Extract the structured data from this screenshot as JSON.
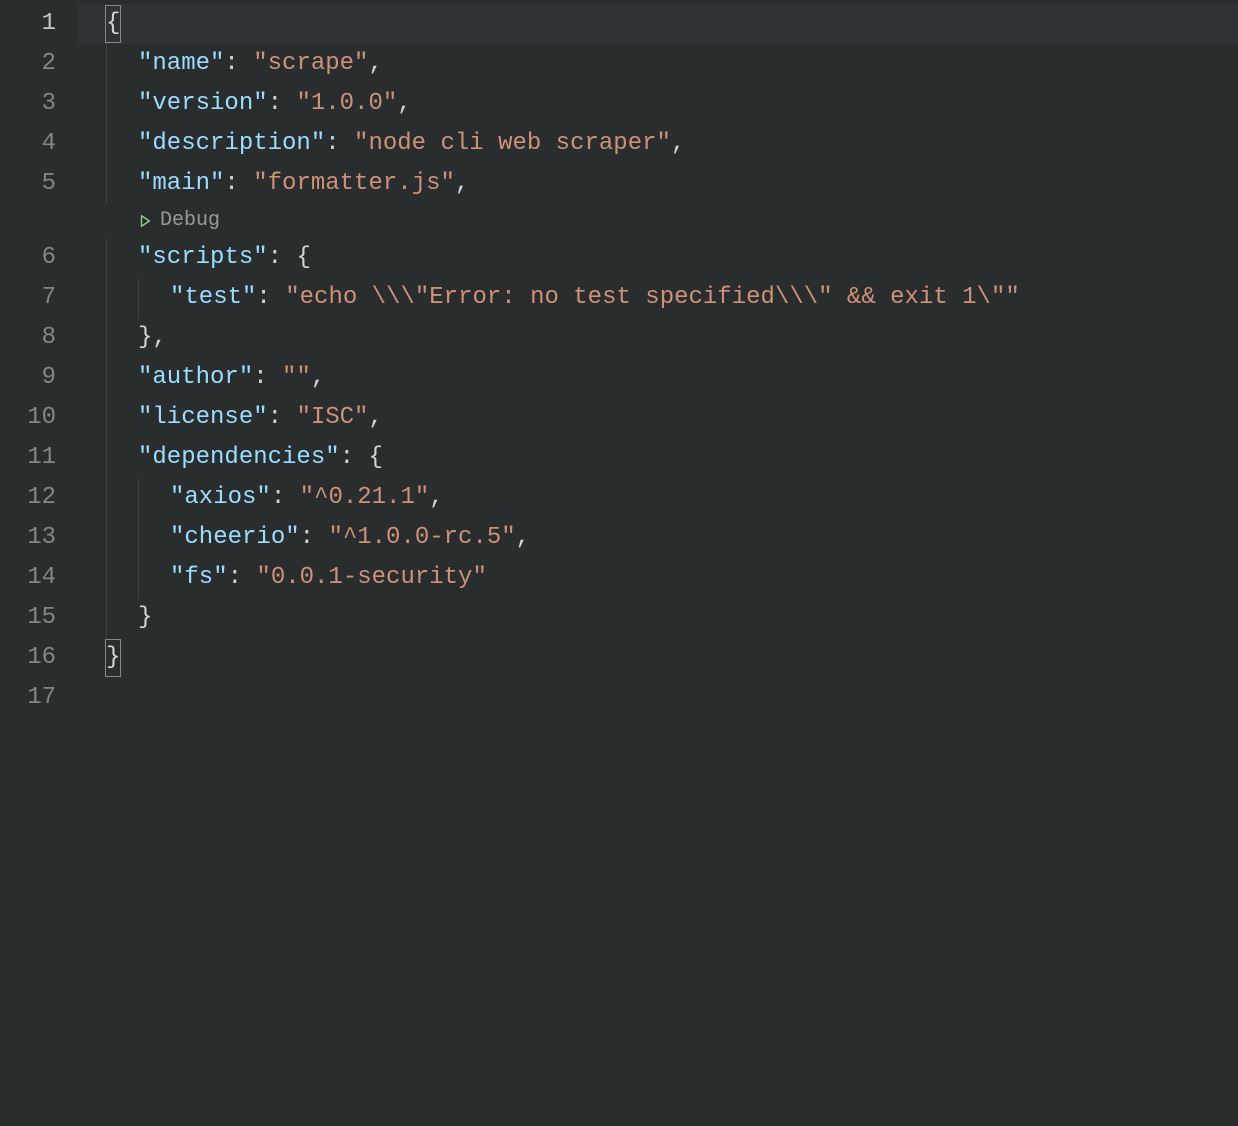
{
  "editor": {
    "line_numbers": [
      "1",
      "2",
      "3",
      "4",
      "5",
      "6",
      "7",
      "8",
      "9",
      "10",
      "11",
      "12",
      "13",
      "14",
      "15",
      "16",
      "17"
    ],
    "current_line_index": 0,
    "codelens": {
      "label": "Debug",
      "before_line_index": 5
    },
    "json": {
      "name_key": "\"name\"",
      "name_val": "\"scrape\"",
      "version_key": "\"version\"",
      "version_val": "\"1.0.0\"",
      "description_key": "\"description\"",
      "description_val": "\"node cli web scraper\"",
      "main_key": "\"main\"",
      "main_val": "\"formatter.js\"",
      "scripts_key": "\"scripts\"",
      "test_key": "\"test\"",
      "test_val": "\"echo \\\\\\\"Error: no test specified\\\\\\\" && exit 1\\\"\"",
      "author_key": "\"author\"",
      "author_val": "\"\"",
      "license_key": "\"license\"",
      "license_val": "\"ISC\"",
      "dependencies_key": "\"dependencies\"",
      "axios_key": "\"axios\"",
      "axios_val": "\"^0.21.1\"",
      "cheerio_key": "\"cheerio\"",
      "cheerio_val": "\"^1.0.0-rc.5\"",
      "fs_key": "\"fs\"",
      "fs_val": "\"0.0.1-security\""
    },
    "punct": {
      "colon": ":",
      "colon_sp": ": ",
      "comma": ",",
      "open_brace": "{",
      "close_brace": "}",
      "close_brace_comma": "},"
    }
  }
}
